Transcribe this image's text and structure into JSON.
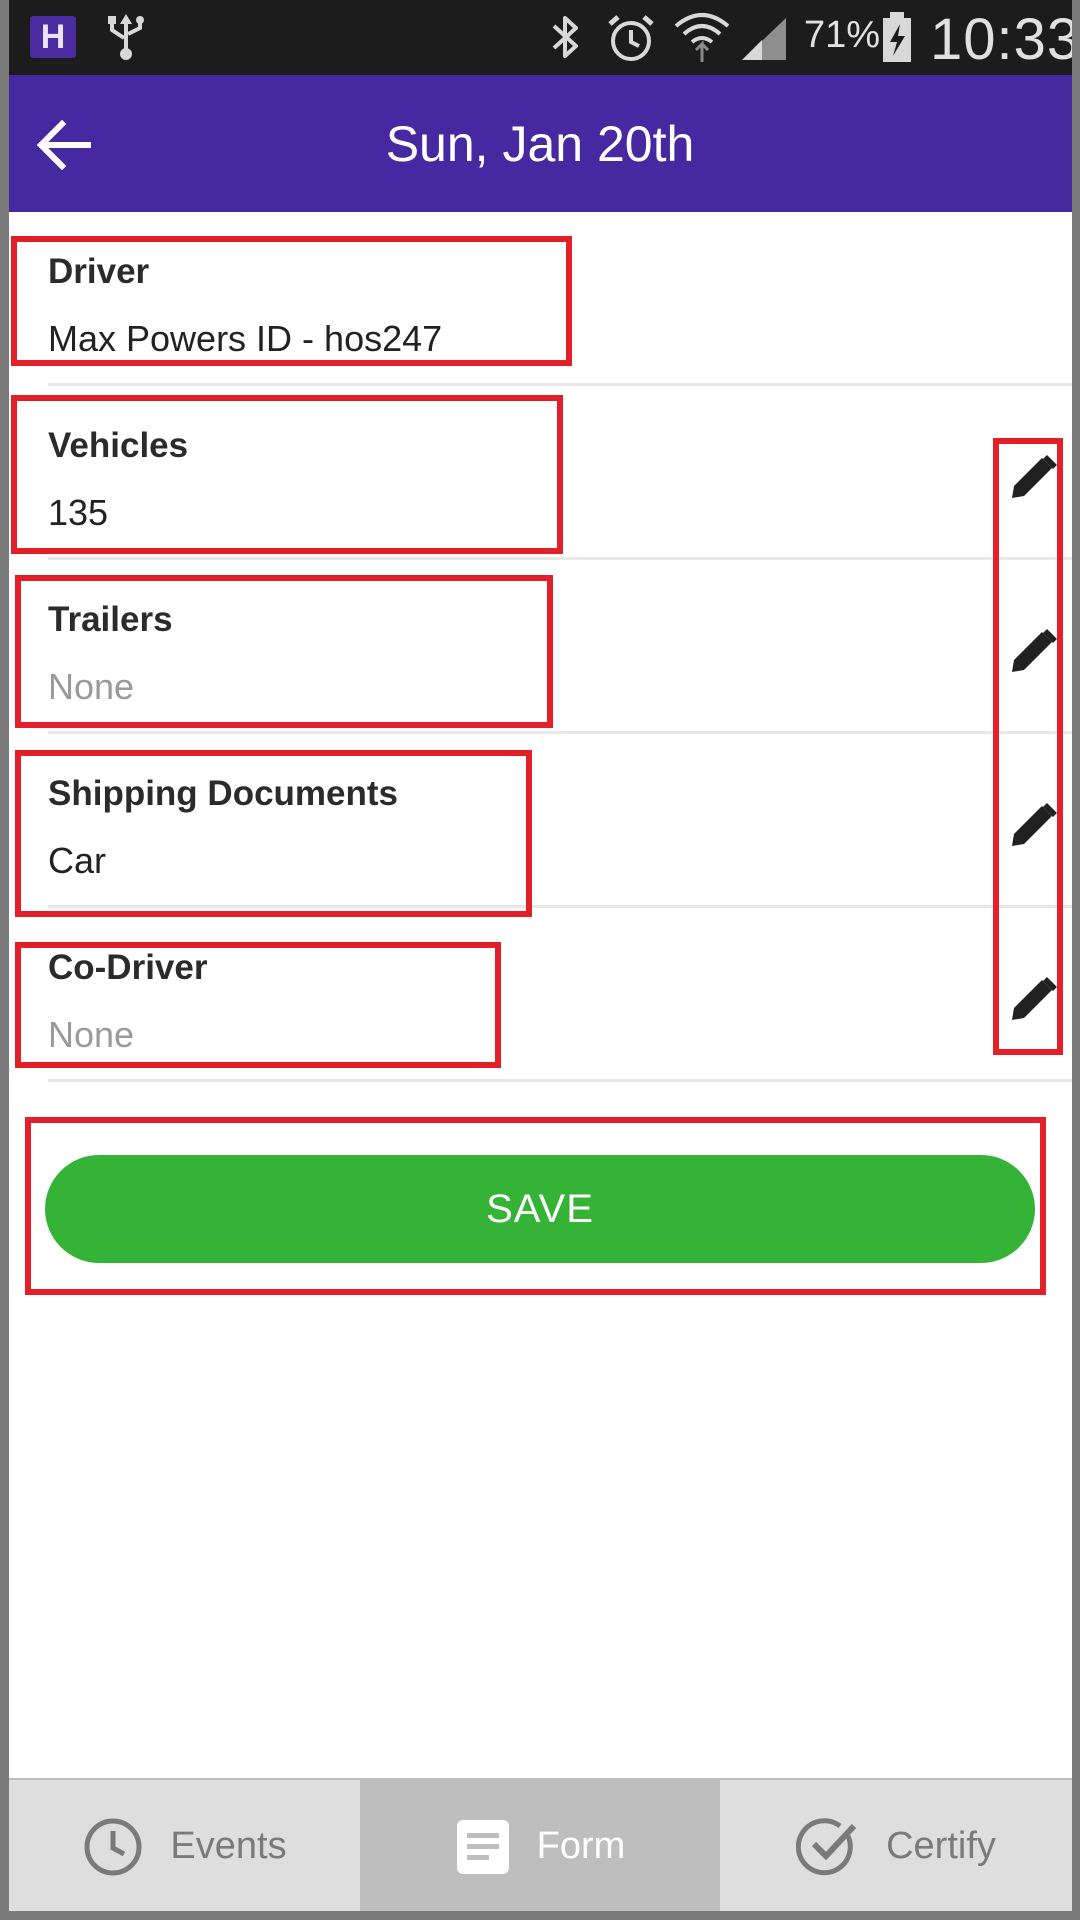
{
  "status_bar": {
    "app_badge": "H",
    "battery_percent": "71%",
    "time": "10:33"
  },
  "app_bar": {
    "title": "Sun, Jan 20th"
  },
  "form": {
    "fields": [
      {
        "label": "Driver",
        "value": "Max Powers ID - hos247"
      },
      {
        "label": "Vehicles",
        "value": "135"
      },
      {
        "label": "Trailers",
        "value": "None"
      },
      {
        "label": "Shipping Documents",
        "value": "Car"
      },
      {
        "label": "Co-Driver",
        "value": "None"
      }
    ]
  },
  "save_label": "SAVE",
  "bottom_nav": {
    "items": [
      {
        "label": "Events",
        "icon": "clock-icon"
      },
      {
        "label": "Form",
        "icon": "document-icon"
      },
      {
        "label": "Certify",
        "icon": "check-circle-icon"
      }
    ],
    "active": "Form"
  },
  "colors": {
    "app_bar": "#4628a0",
    "save_button": "#35b336",
    "highlight": "#e3202a"
  }
}
